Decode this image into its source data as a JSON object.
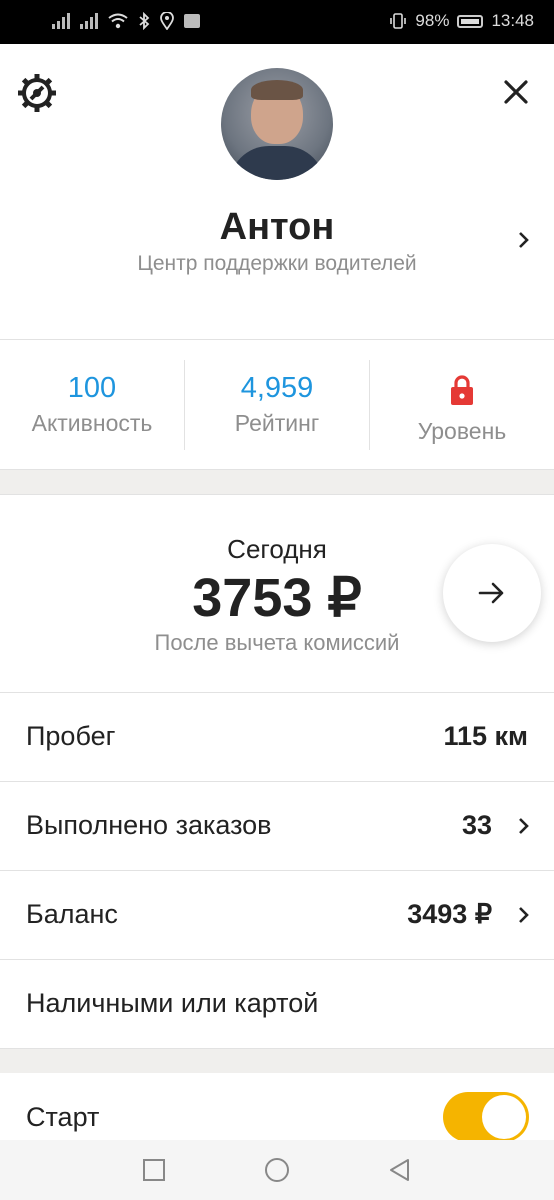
{
  "status_bar": {
    "battery": "98%",
    "time": "13:48"
  },
  "profile": {
    "name": "Антон",
    "subtitle": "Центр поддержки водителей"
  },
  "stats": [
    {
      "value": "100",
      "label": "Активность"
    },
    {
      "value": "4,959",
      "label": "Рейтинг"
    },
    {
      "value": "",
      "label": "Уровень",
      "icon": "lock-icon"
    }
  ],
  "today": {
    "label": "Сегодня",
    "amount": "3753 ₽",
    "note": "После вычета комиссий"
  },
  "rows": [
    {
      "label": "Пробег",
      "value": "115 км"
    },
    {
      "label": "Выполнено заказов",
      "value": "33"
    },
    {
      "label": "Баланс",
      "value": "3493 ₽"
    },
    {
      "label": "Наличными или картой",
      "value": ""
    }
  ],
  "start": {
    "label": "Старт",
    "enabled": true
  },
  "colors": {
    "accent_blue": "#1e95de",
    "toggle_yellow": "#f5b400",
    "lock_red": "#e53935"
  }
}
